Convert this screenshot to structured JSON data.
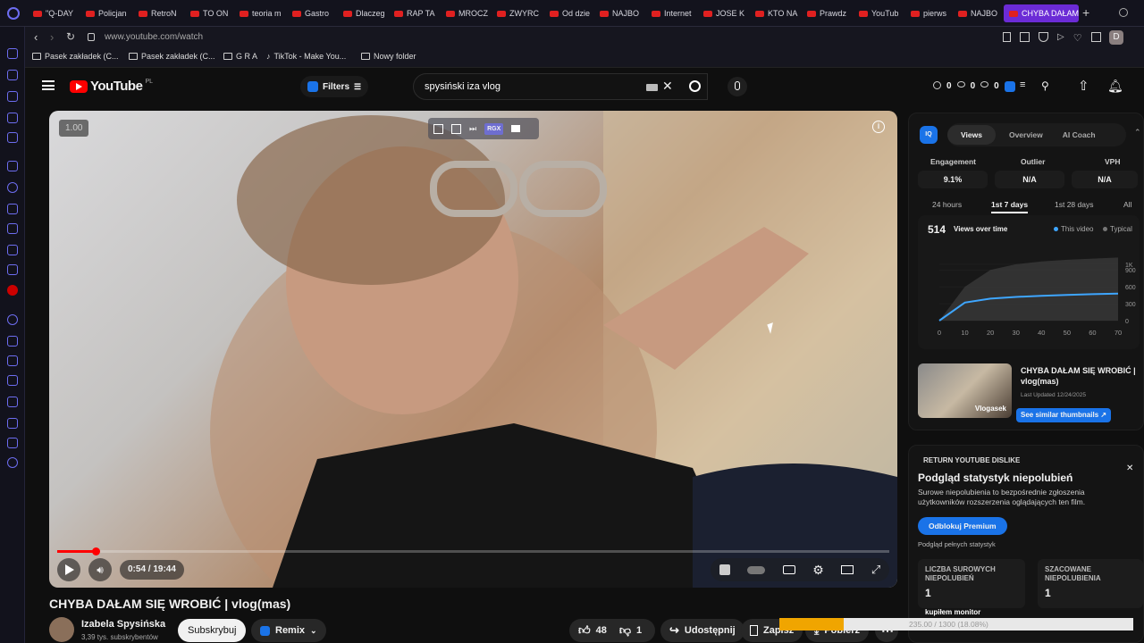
{
  "browser": {
    "tabs": [
      {
        "label": "\"Q-DAY"
      },
      {
        "label": "Policjan"
      },
      {
        "label": "RetroN"
      },
      {
        "label": "TO ON"
      },
      {
        "label": "teoria m"
      },
      {
        "label": "Gastro"
      },
      {
        "label": "Dlaczeg"
      },
      {
        "label": "RAP TA"
      },
      {
        "label": "MROCZ"
      },
      {
        "label": "ZWYRC"
      },
      {
        "label": "Od dzie"
      },
      {
        "label": "NAJBO"
      },
      {
        "label": "Internet"
      },
      {
        "label": "JOSE K"
      },
      {
        "label": "KTO NA"
      },
      {
        "label": "Prawdz"
      },
      {
        "label": "YouTub"
      },
      {
        "label": "pierws"
      },
      {
        "label": "NAJBO"
      }
    ],
    "active_tab": "CHYBA DAŁAM",
    "url": "www.youtube.com/watch",
    "bookmarks": [
      "Pasek zakładek (C...",
      "Pasek zakładek (C...",
      "G R A",
      "TikTok - Make You...",
      "Nowy folder"
    ],
    "profile_initial": "D"
  },
  "header": {
    "logo": "YouTube",
    "country": "PL",
    "filters_label": "Filters",
    "search_value": "spysiński iza vlog",
    "counters": [
      "0",
      "0",
      "0"
    ]
  },
  "player": {
    "speed": "1.00",
    "time": "0:54 / 19:44",
    "progress": 0.046,
    "rgx": "RGX"
  },
  "video": {
    "title": "CHYBA DAŁAM SIĘ WROBIĆ | vlog(mas)",
    "channel": "Izabela Spysińska",
    "subs": "3,39 tys. subskrybentów",
    "subscribe": "Subskrybuj",
    "remix": "Remix",
    "likes": "48",
    "dislikes": "1",
    "share": "Udostępnij",
    "save": "Zapisz",
    "download": "Pobierz"
  },
  "vidiq": {
    "tabs": [
      "Views",
      "Overview",
      "AI Coach"
    ],
    "metrics": [
      {
        "label": "Engagement",
        "value": "9.1%"
      },
      {
        "label": "Outlier",
        "value": "N/A"
      },
      {
        "label": "VPH",
        "value": "N/A"
      }
    ],
    "ranges": [
      "24 hours",
      "1st 7 days",
      "1st 28 days",
      "All"
    ],
    "views": "514",
    "views_dropdown": "Views over time",
    "legend_this": "This video",
    "legend_typical": "Typical",
    "thumb_title": "CHYBA DAŁAM SIĘ WROBIĆ | vlog(mas)",
    "thumb_updated": "Last Updated 12/24/2025",
    "thumb_label": "Vlogasek",
    "similar_btn": "See similar thumbnails ↗"
  },
  "chart_data": {
    "type": "area",
    "x": [
      0,
      10,
      20,
      30,
      40,
      50,
      60,
      70
    ],
    "xticks": [
      "0",
      "10",
      "20",
      "30",
      "40",
      "50",
      "60",
      "70"
    ],
    "yticks": [
      "0",
      "300",
      "600",
      "900",
      "1K"
    ],
    "ylim": [
      0,
      1300
    ],
    "series": [
      {
        "name": "This video",
        "values": [
          0,
          320,
          390,
          420,
          440,
          455,
          470,
          480
        ]
      },
      {
        "name": "Typical",
        "values": [
          0,
          600,
          900,
          1000,
          1050,
          1080,
          1100,
          1120
        ]
      }
    ]
  },
  "rytd": {
    "header": "RETURN YOUTUBE DISLIKE",
    "title": "Podgląd statystyk niepolubień",
    "desc": "Surowe niepolubienia to bezpośrednie zgłoszenia użytkowników rozszerzenia oglądających ten film.",
    "unlock": "Odblokuj Premium",
    "preview": "Podgląd pełnych statystyk",
    "raw_label": "LICZBA SUROWYCH NIEPOLUBIEŃ",
    "raw_value": "1",
    "est_label": "SZACOWANE NIEPOLUBIENIA",
    "est_value": "1"
  },
  "overlay": {
    "monitor_text": "kupiłem monitor",
    "progress_text": "235.00 / 1300 (18.08%)",
    "progress_fraction": 0.1808
  },
  "colors": {
    "accent_blue": "#3ea6ff",
    "yt_red": "#ff0000",
    "vidiq_blue": "#1a73e8",
    "opera_purple": "#6b2bd6",
    "overlay_orange": "#f0a500"
  }
}
